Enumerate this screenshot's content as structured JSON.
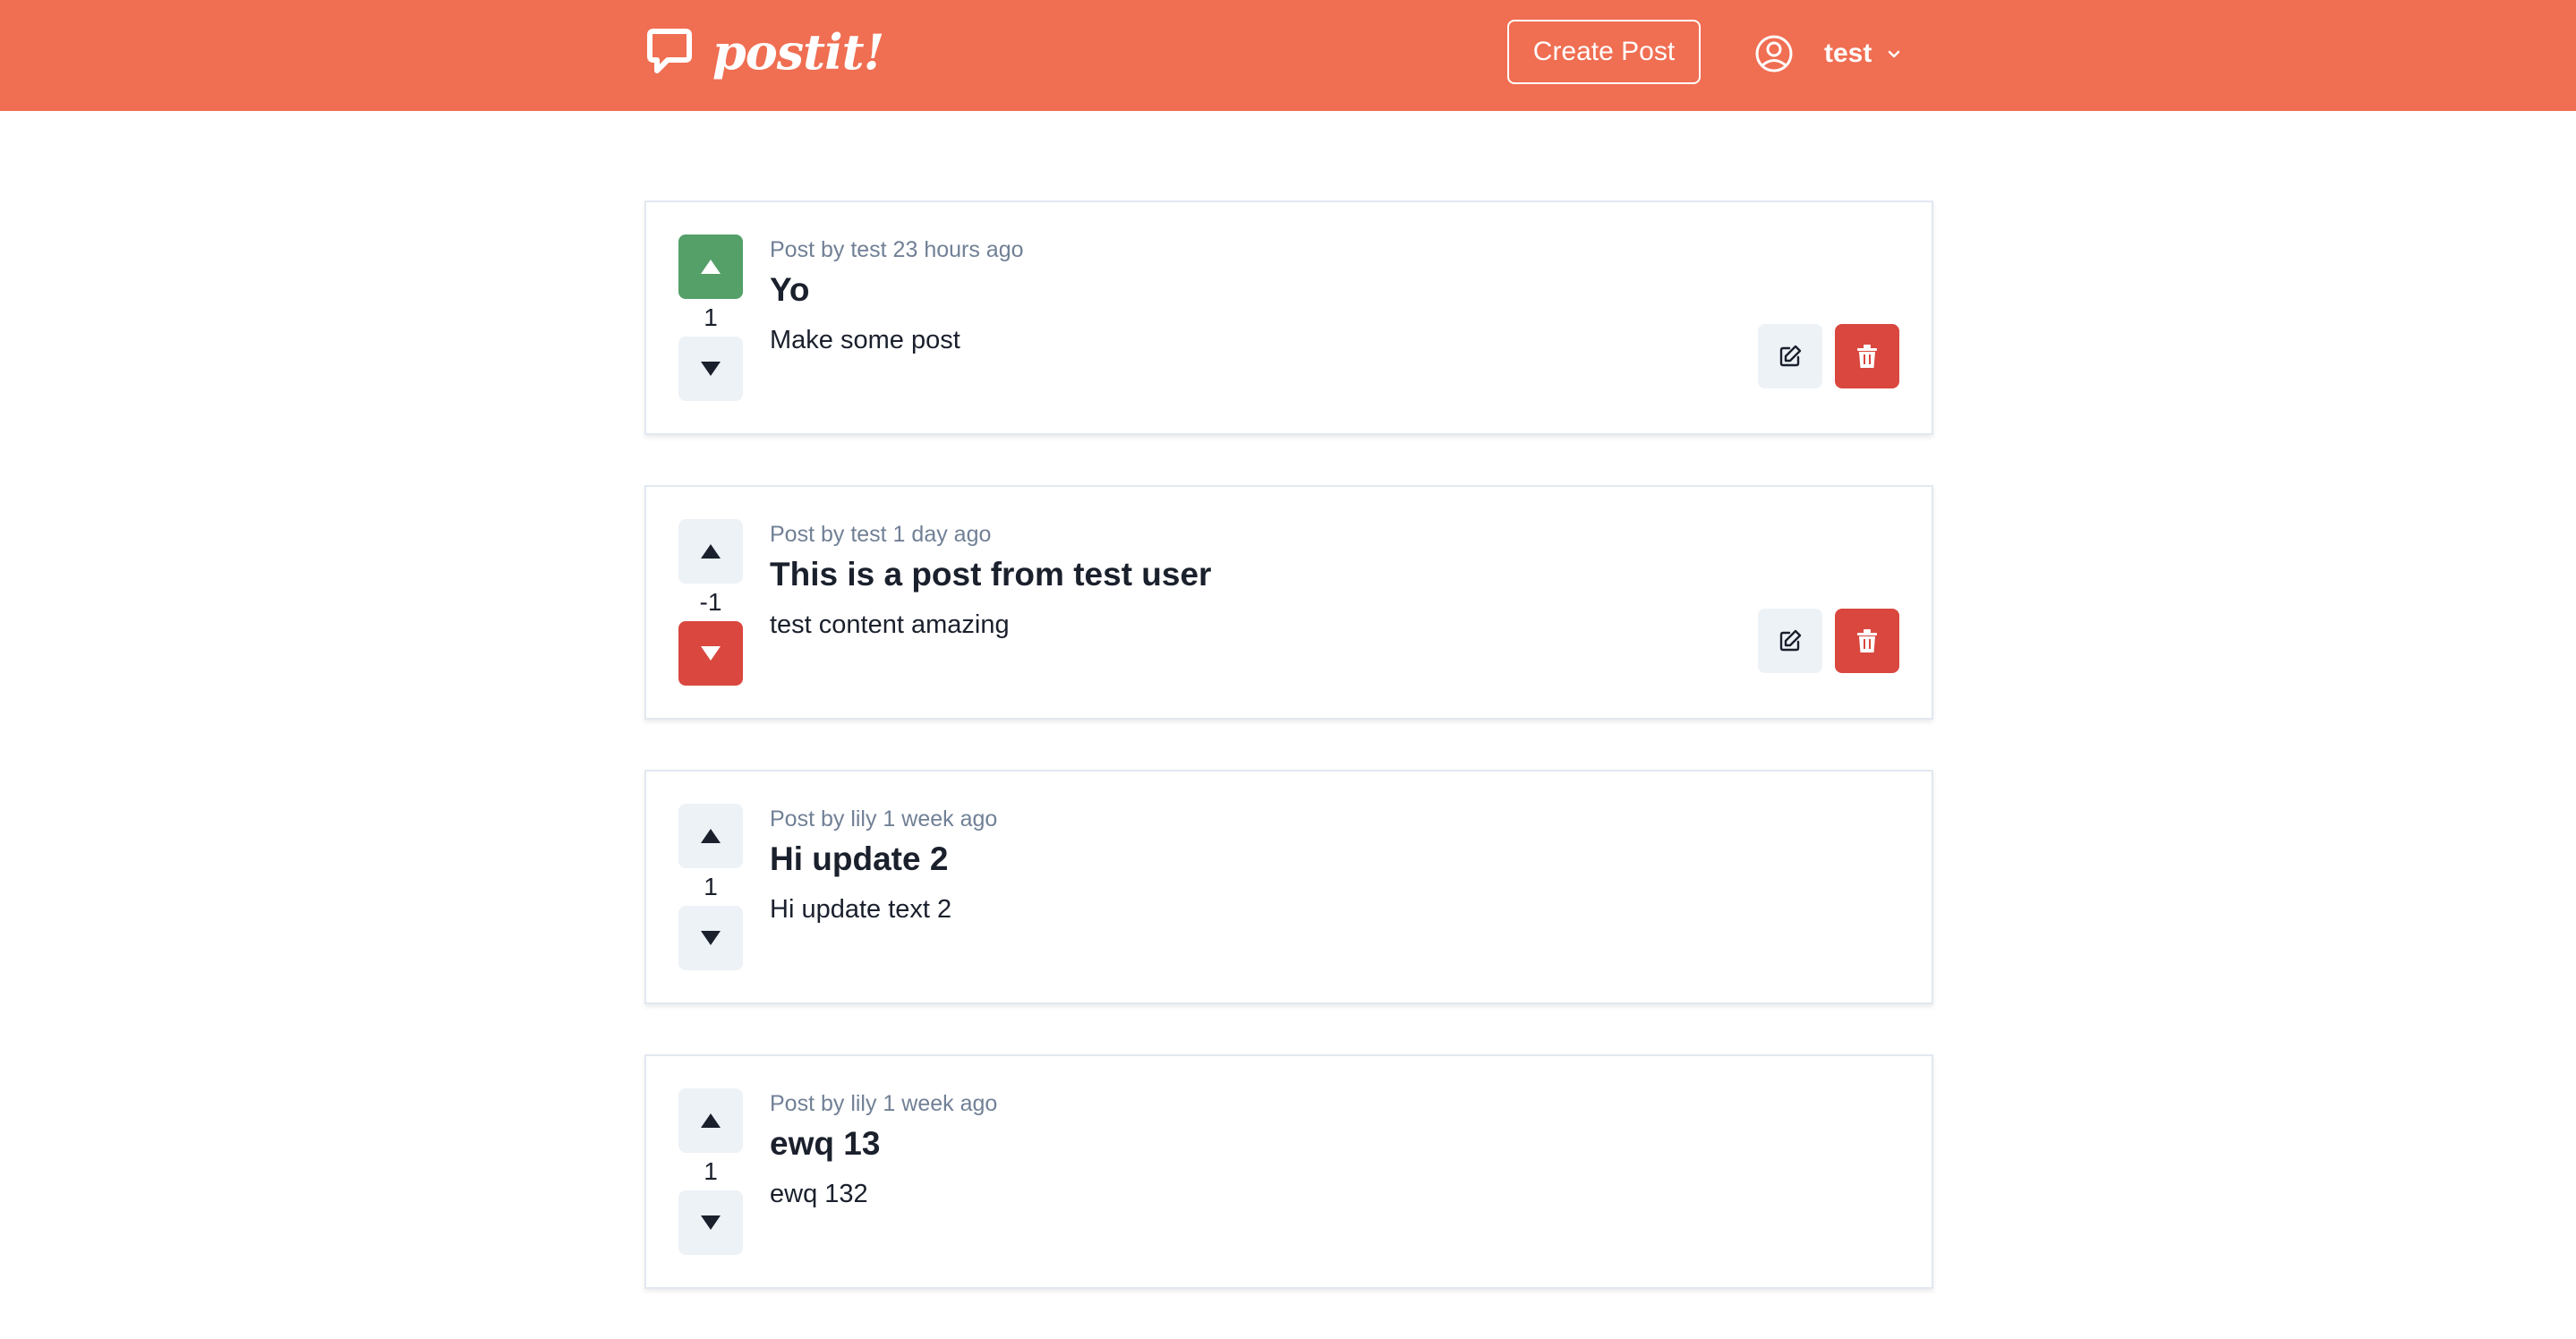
{
  "header": {
    "logo_text": "postit!",
    "create_label": "Create Post",
    "username": "test",
    "bg_color": "#f06e52"
  },
  "posts": [
    {
      "meta": "Post by test 23 hours ago",
      "title": "Yo",
      "body": "Make some post",
      "votes": "1",
      "vote_state": "up",
      "owned": true
    },
    {
      "meta": "Post by test 1 day ago",
      "title": "This is a post from test user",
      "body": "test content amazing",
      "votes": "-1",
      "vote_state": "down",
      "owned": true
    },
    {
      "meta": "Post by lily 1 week ago",
      "title": "Hi update 2",
      "body": "Hi update text 2",
      "votes": "1",
      "vote_state": "none",
      "owned": false
    },
    {
      "meta": "Post by lily 1 week ago",
      "title": "ewq 13",
      "body": "ewq 132",
      "votes": "1",
      "vote_state": "none",
      "owned": false
    }
  ],
  "colors": {
    "upvote_active": "#54a068",
    "downvote_active": "#d9473f",
    "delete": "#d9473f",
    "neutral_button": "#edf2f7"
  },
  "icons": [
    "chat-bubble-icon",
    "user-circle-icon",
    "chevron-down-icon",
    "triangle-up-icon",
    "triangle-down-icon",
    "pencil-square-icon",
    "trash-icon"
  ]
}
